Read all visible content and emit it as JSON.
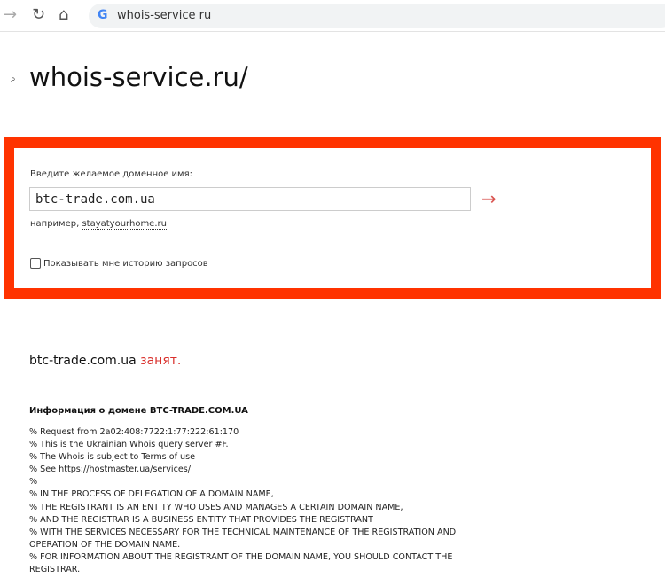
{
  "browser": {
    "url": "whois-service ru"
  },
  "page": {
    "title": "whois-service.ru/"
  },
  "form": {
    "label": "Введите желаемое доменное имя:",
    "value": "btc-trade.com.ua",
    "submit": "→",
    "example_prefix": "например, ",
    "example_link": "stayatyourhome.ru",
    "history_label": "Показывать мне историю запросов",
    "history_checked": false
  },
  "result": {
    "domain": "btc-trade.com.ua",
    "status": "занят."
  },
  "info": {
    "heading": "Информация о домене BTC-TRADE.COM.UA",
    "lines": [
      "% Request from 2a02:408:7722:1:77:222:61:170",
      "% This is the Ukrainian Whois query server #F.",
      "% The Whois is subject to Terms of use",
      "% See https://hostmaster.ua/services/",
      "%",
      "% IN THE PROCESS OF DELEGATION OF A DOMAIN NAME,",
      "% THE REGISTRANT IS AN ENTITY WHO USES AND MANAGES A CERTAIN DOMAIN NAME,",
      "% AND THE REGISTRAR IS A BUSINESS ENTITY THAT PROVIDES THE REGISTRANT",
      "% WITH THE SERVICES NECESSARY FOR THE TECHNICAL MAINTENANCE OF THE REGISTRATION AND OPERATION OF THE DOMAIN NAME.",
      "% FOR INFORMATION ABOUT THE REGISTRANT OF THE DOMAIN NAME, YOU SHOULD CONTACT THE REGISTRAR."
    ]
  },
  "colors": {
    "accent": "#ff3300",
    "status": "#d9302c"
  }
}
